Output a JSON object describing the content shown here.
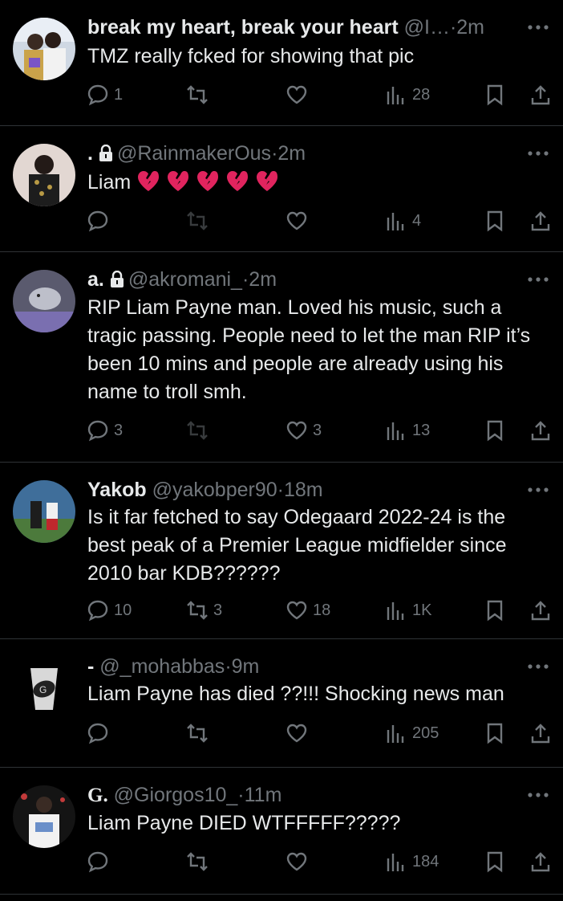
{
  "tweets": [
    {
      "name": "break my heart, break your heart",
      "handle": "@I…",
      "separator": "·",
      "time": "2m",
      "text": "TMZ really fcked for showing that pic",
      "replies": "1",
      "retweets": "",
      "likes": "",
      "views": "28"
    },
    {
      "name": ".",
      "handle": "@RainmakerOus",
      "separator": "·",
      "time": "2m",
      "text": "Liam",
      "emoji": [
        "broken-heart",
        "broken-heart",
        "broken-heart",
        "broken-heart",
        "broken-heart"
      ],
      "replies": "",
      "retweets": "",
      "likes": "",
      "views": "4"
    },
    {
      "name": "a.",
      "handle": "@akromani_",
      "separator": "·",
      "time": "2m",
      "text": "RIP Liam Payne man. Loved his music, such a tragic passing. People need to let the man RIP it’s been 10 mins and people are already using his name to troll smh.",
      "replies": "3",
      "retweets": "",
      "likes": "3",
      "views": "13"
    },
    {
      "name": "Yakob",
      "handle": "@yakobper90",
      "separator": "·",
      "time": "18m",
      "text": "Is it far fetched to say Odegaard 2022-24 is the best peak of a Premier League midfielder since 2010 bar KDB??????",
      "replies": "10",
      "retweets": "3",
      "likes": "18",
      "views": "1K"
    },
    {
      "name": "-",
      "handle": "@_mohabbas",
      "separator": "·",
      "time": "9m",
      "text": "Liam Payne has died ??!!! Shocking news man",
      "replies": "",
      "retweets": "",
      "likes": "",
      "views": "205"
    },
    {
      "name": "G.",
      "handle": "@Giorgos10_",
      "separator": "·",
      "time": "11m",
      "text": "Liam Payne DIED WTFFFFF?????",
      "replies": "",
      "retweets": "",
      "likes": "",
      "views": "184"
    }
  ],
  "icons": {
    "reply": "speech-bubble-icon",
    "retweet": "retweet-arrows-icon",
    "like": "heart-outline-icon",
    "views": "bar-chart-icon",
    "bookmark": "bookmark-icon",
    "share": "share-upload-icon",
    "more": "three-dots-icon",
    "lock": "lock-icon"
  },
  "colors": {
    "background": "#000000",
    "text": "#e7e9ea",
    "muted": "#71767b",
    "divider": "#2f3336",
    "emoji": "#e0245e"
  }
}
